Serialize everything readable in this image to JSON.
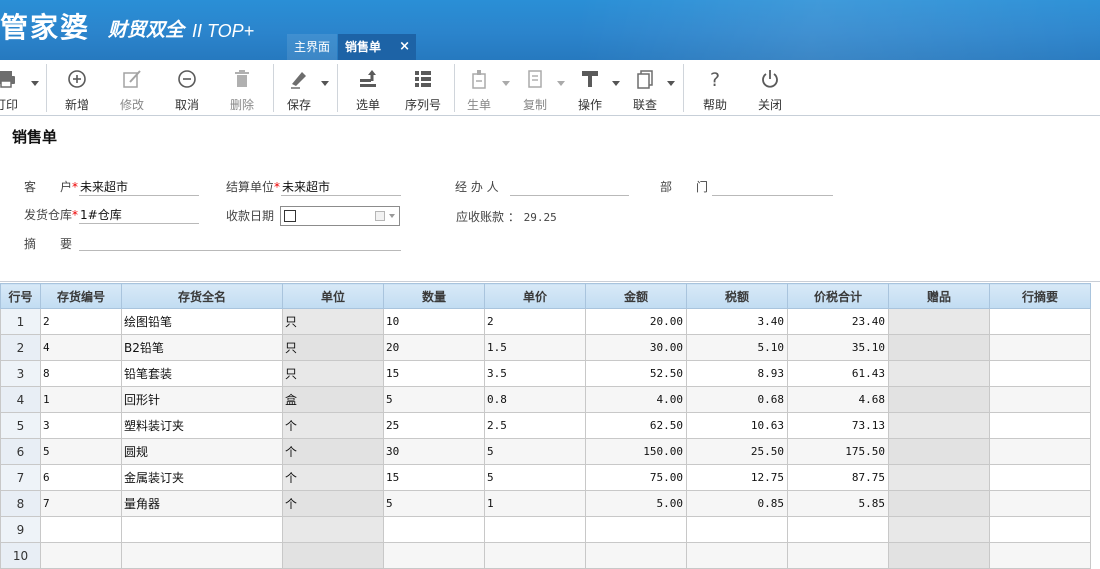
{
  "header": {
    "logo_main": "管家婆",
    "logo_sub": "财贸双全",
    "logo_version": "II TOP+",
    "tabs": [
      {
        "label": "主界面"
      },
      {
        "label": "销售单",
        "close": "×"
      }
    ]
  },
  "toolbar": {
    "print": "打印",
    "new": "新增",
    "edit": "修改",
    "cancel": "取消",
    "delete": "删除",
    "save": "保存",
    "select": "选单",
    "serial": "序列号",
    "generate": "生单",
    "copy": "复制",
    "operate": "操作",
    "query": "联查",
    "help": "帮助",
    "close": "关闭"
  },
  "form": {
    "title": "销售单",
    "customer_label": "客　　户",
    "customer_value": "未来超市",
    "settle_label": "结算单位",
    "settle_value": "未来超市",
    "handler_label": "经 办 人",
    "handler_value": "",
    "dept_label": "部　　门",
    "dept_value": "",
    "warehouse_label": "发货仓库",
    "warehouse_value": "1#仓库",
    "date_label": "收款日期",
    "ar_label": "应收账款 ：",
    "ar_value": "29.25",
    "memo_label": "摘　　要",
    "memo_value": "",
    "required_mark": "*"
  },
  "grid": {
    "columns": [
      "行号",
      "存货编号",
      "存货全名",
      "单位",
      "数量",
      "单价",
      "金额",
      "税额",
      "价税合计",
      "赠品",
      "行摘要"
    ],
    "rows": [
      {
        "no": "1",
        "code": "2",
        "name": "绘图铅笔",
        "unit": "只",
        "qty": "10",
        "price": "2",
        "amount": "20.00",
        "tax": "3.40",
        "total": "23.40",
        "gift": "",
        "memo": ""
      },
      {
        "no": "2",
        "code": "4",
        "name": "B2铅笔",
        "unit": "只",
        "qty": "20",
        "price": "1.5",
        "amount": "30.00",
        "tax": "5.10",
        "total": "35.10",
        "gift": "",
        "memo": ""
      },
      {
        "no": "3",
        "code": "8",
        "name": "铅笔套装",
        "unit": "只",
        "qty": "15",
        "price": "3.5",
        "amount": "52.50",
        "tax": "8.93",
        "total": "61.43",
        "gift": "",
        "memo": ""
      },
      {
        "no": "4",
        "code": "1",
        "name": "回形针",
        "unit": "盒",
        "qty": "5",
        "price": "0.8",
        "amount": "4.00",
        "tax": "0.68",
        "total": "4.68",
        "gift": "",
        "memo": ""
      },
      {
        "no": "5",
        "code": "3",
        "name": "塑料装订夹",
        "unit": "个",
        "qty": "25",
        "price": "2.5",
        "amount": "62.50",
        "tax": "10.63",
        "total": "73.13",
        "gift": "",
        "memo": ""
      },
      {
        "no": "6",
        "code": "5",
        "name": "圆规",
        "unit": "个",
        "qty": "30",
        "price": "5",
        "amount": "150.00",
        "tax": "25.50",
        "total": "175.50",
        "gift": "",
        "memo": ""
      },
      {
        "no": "7",
        "code": "6",
        "name": "金属装订夹",
        "unit": "个",
        "qty": "15",
        "price": "5",
        "amount": "75.00",
        "tax": "12.75",
        "total": "87.75",
        "gift": "",
        "memo": ""
      },
      {
        "no": "8",
        "code": "7",
        "name": "量角器",
        "unit": "个",
        "qty": "5",
        "price": "1",
        "amount": "5.00",
        "tax": "0.85",
        "total": "5.85",
        "gift": "",
        "memo": ""
      },
      {
        "no": "9",
        "code": "",
        "name": "",
        "unit": "",
        "qty": "",
        "price": "",
        "amount": "",
        "tax": "",
        "total": "",
        "gift": "",
        "memo": ""
      },
      {
        "no": "10",
        "code": "",
        "name": "",
        "unit": "",
        "qty": "",
        "price": "",
        "amount": "",
        "tax": "",
        "total": "",
        "gift": "",
        "memo": ""
      }
    ]
  },
  "colors": {
    "header_blue": "#2b84cc",
    "active_tab": "#1d63a6",
    "grid_header": "#c1dcf2",
    "required": "#e00000"
  },
  "icons": [
    "printer-icon",
    "plus-circle-icon",
    "edit-icon",
    "minus-circle-icon",
    "trash-icon",
    "save-icon",
    "select-bill-icon",
    "serial-list-icon",
    "generate-bill-icon",
    "copy-icon",
    "operate-icon",
    "query-icon",
    "help-icon",
    "power-icon"
  ]
}
